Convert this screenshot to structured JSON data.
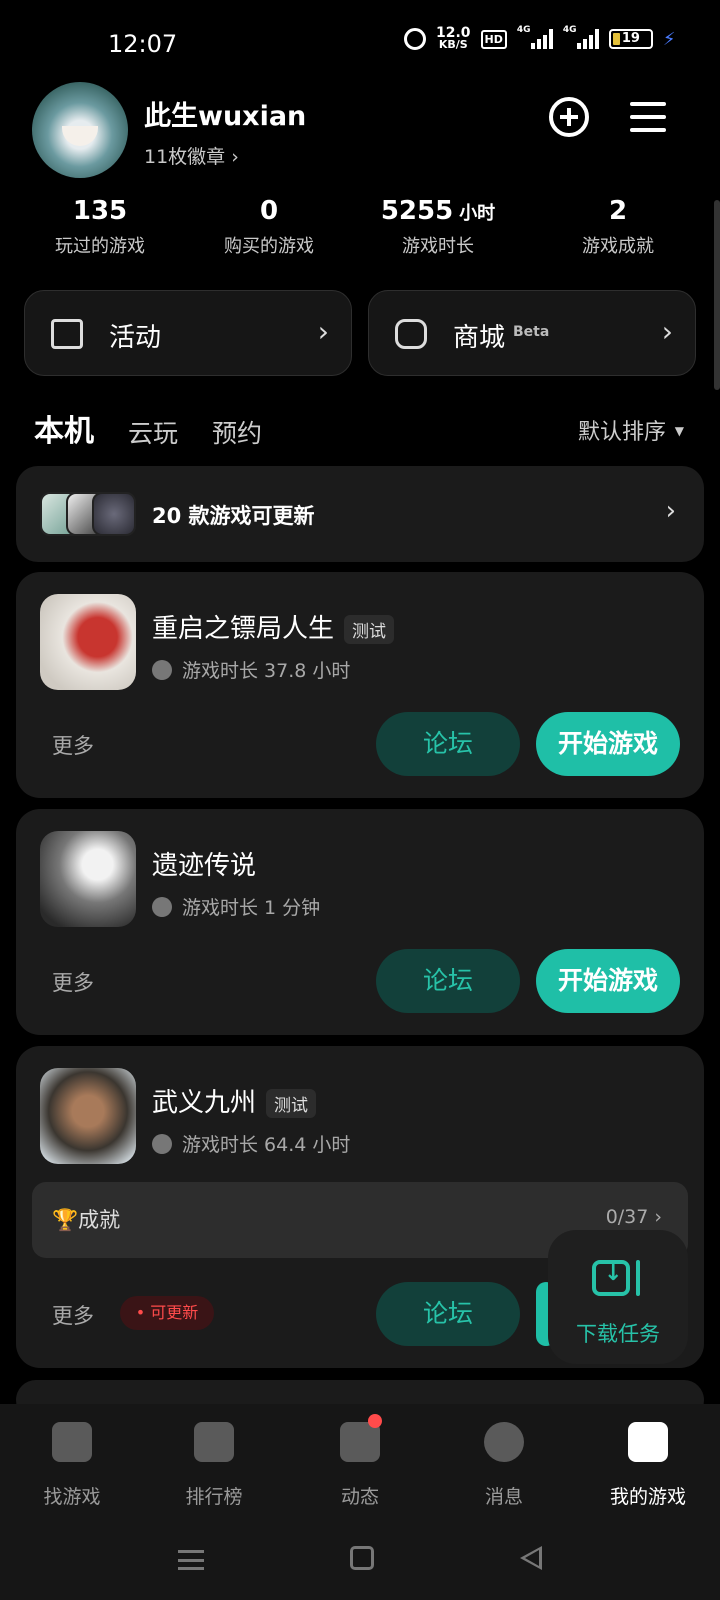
{
  "status_bar": {
    "time": "12:07",
    "net_speed": "12.0",
    "net_unit": "KB/S",
    "hd": "HD",
    "sig1": "4G",
    "sig2": "4G",
    "battery": "19"
  },
  "profile": {
    "username": "此生wuxian",
    "badges": "11枚徽章 ›"
  },
  "stats": [
    {
      "value": "135",
      "unit": "",
      "label": "玩过的游戏"
    },
    {
      "value": "0",
      "unit": "",
      "label": "购买的游戏"
    },
    {
      "value": "5255",
      "unit": "小时",
      "label": "游戏时长"
    },
    {
      "value": "2",
      "unit": "",
      "label": "游戏成就"
    }
  ],
  "quick": {
    "activity": "活动",
    "store": "商城",
    "store_badge": "Beta"
  },
  "tabs": [
    "本机",
    "云玩",
    "预约"
  ],
  "sort_label": "默认排序",
  "update_banner": "20 款游戏可更新",
  "games": [
    {
      "name": "重启之镖局人生",
      "tag": "测试",
      "playtime": "游戏时长 37.8 小时"
    },
    {
      "name": "遗迹传说",
      "tag": "",
      "playtime": "游戏时长 1 分钟"
    },
    {
      "name": "武义九州",
      "tag": "测试",
      "playtime": "游戏时长 64.4 小时",
      "achievement_label": "🏆成就",
      "achievement_count": "0/37 ›",
      "update_badge": "• 可更新"
    }
  ],
  "actions": {
    "more": "更多",
    "forum": "论坛",
    "play": "开始游戏"
  },
  "download_task": "下载任务",
  "nav": [
    "找游戏",
    "排行榜",
    "动态",
    "消息",
    "我的游戏"
  ],
  "colors": {
    "accent": "#1fbfa7",
    "update_red": "#ff4b4b"
  }
}
